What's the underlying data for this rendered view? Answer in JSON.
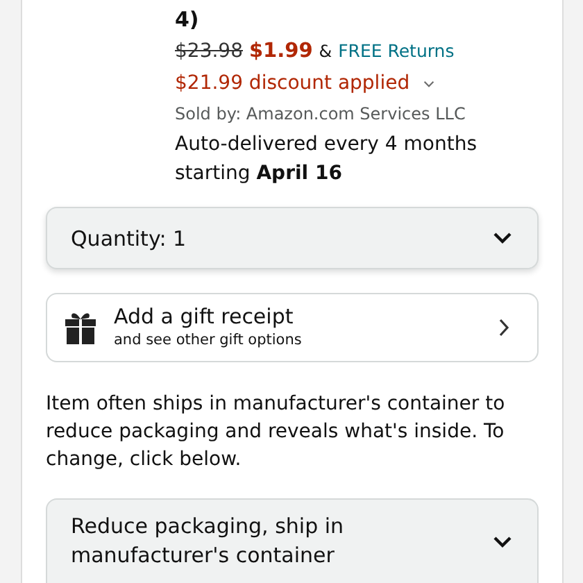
{
  "product": {
    "title_tail": "4)",
    "list_price": "$23.98",
    "price": "$1.99",
    "returns_prefix": "&",
    "returns": "FREE Returns",
    "discount": "$21.99 discount applied",
    "discount_expanded": false,
    "seller": "Sold by: Amazon.com Services LLC",
    "delivery": "Auto-delivered every 4 months starting **April 16**"
  },
  "quantity": {
    "label": "Quantity: 1"
  },
  "gift": {
    "title": "Add a gift receipt",
    "subtitle": "and see other gift options"
  },
  "packaging_note": "Item often ships in manufacturer's container to reduce packaging and reveals what's inside. To change, click below.",
  "packaging": {
    "label": "Reduce packaging, ship in manufacturer's container"
  }
}
